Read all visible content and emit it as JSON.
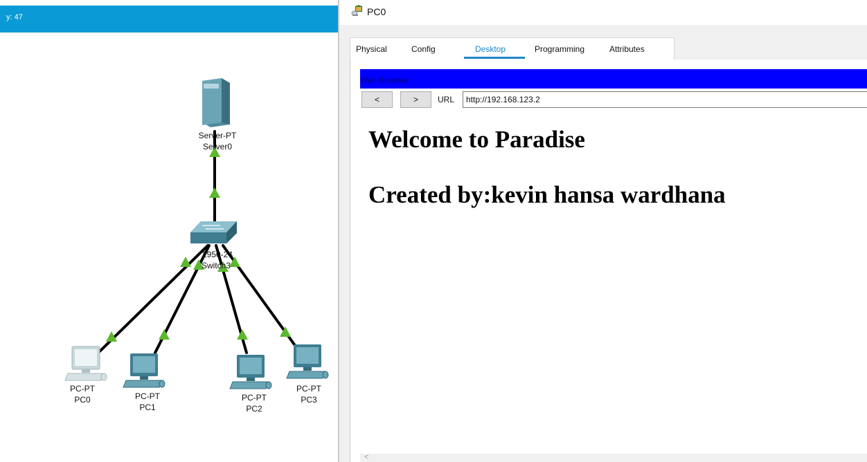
{
  "workspace": {
    "coordinate_text": "y: 47",
    "header_color": "#0a9ad6",
    "link_arrow_color": "#5cb82e",
    "devices": {
      "server": {
        "model": "Server-PT",
        "name": "Server0"
      },
      "switch": {
        "model": "2950-24",
        "name": "Switch3"
      },
      "pcs": [
        {
          "model": "PC-PT",
          "name": "PC0"
        },
        {
          "model": "PC-PT",
          "name": "PC1"
        },
        {
          "model": "PC-PT",
          "name": "PC2"
        },
        {
          "model": "PC-PT",
          "name": "PC3"
        }
      ]
    }
  },
  "window": {
    "title": "PC0",
    "icon": "pc-window-icon",
    "tabs": [
      "Physical",
      "Config",
      "Desktop",
      "Programming",
      "Attributes"
    ],
    "active_tab": "Desktop",
    "accent_color": "#1e88c9"
  },
  "browser": {
    "title": "Web Browser",
    "titlebar_color": "#0000ff",
    "back_label": "<",
    "forward_label": ">",
    "url_label": "URL",
    "url_value": "http://192.168.123.2",
    "page": {
      "heading1": "Welcome to Paradise",
      "heading2": "Created by:kevin hansa wardhana"
    },
    "scroll_arrow": "<"
  }
}
